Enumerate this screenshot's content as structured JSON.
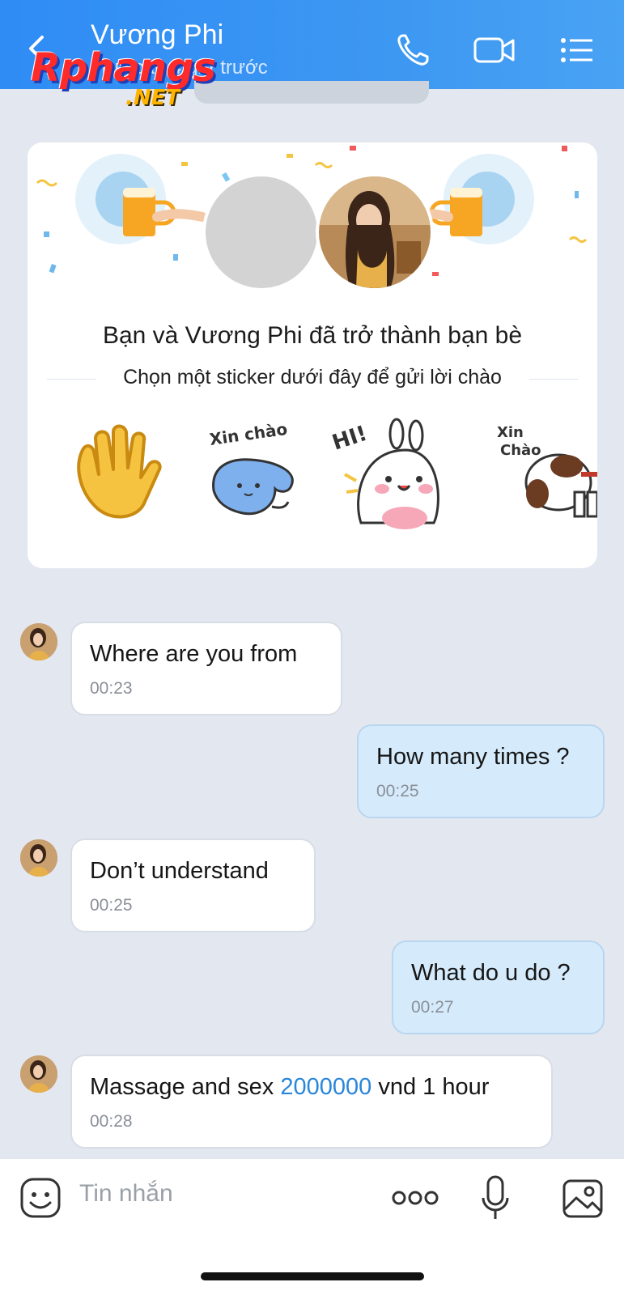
{
  "header": {
    "title": "Vương Phi",
    "subtitle": "Truy cập 4 giờ trước",
    "back_icon": "back-arrow-icon",
    "call_icon": "phone-icon",
    "video_icon": "video-camera-icon",
    "menu_icon": "list-menu-icon",
    "bg_color": "#3c97f2"
  },
  "watermark": {
    "text": "Rphangs",
    "suffix": ".NET"
  },
  "friend_card": {
    "title": "Bạn và Vương Phi đã trở thành bạn bè",
    "subtitle": "Chọn một sticker dưới đây để gửi lời chào",
    "stickers": [
      {
        "name": "waving-hand-sticker",
        "text": ""
      },
      {
        "name": "blue-cat-sticker",
        "text": "Xin chào"
      },
      {
        "name": "bunny-sticker",
        "text": "HI!"
      },
      {
        "name": "dog-sticker",
        "text": "Xin Chào"
      }
    ]
  },
  "messages": [
    {
      "dir": "in",
      "text": "Where are you from",
      "time": "00:23"
    },
    {
      "dir": "out",
      "text": "How many times ?",
      "time": "00:25"
    },
    {
      "dir": "in",
      "text": "Don’t understand",
      "time": "00:25"
    },
    {
      "dir": "out",
      "text": "What do u do ?",
      "time": "00:27"
    },
    {
      "dir": "in",
      "text_before": "Massage and sex ",
      "text_link": "2000000",
      "text_after": " vnd 1 hour",
      "time": "00:28"
    }
  ],
  "composer": {
    "placeholder": "Tin nhắn",
    "emoji_icon": "emoji-icon",
    "more_icon": "more-dots-icon",
    "mic_icon": "microphone-icon",
    "image_icon": "image-icon"
  },
  "colors": {
    "accent": "#2f8cf5",
    "out_bubble": "#d5ebfb",
    "link": "#2a86d9",
    "background": "#e3e7ef"
  }
}
